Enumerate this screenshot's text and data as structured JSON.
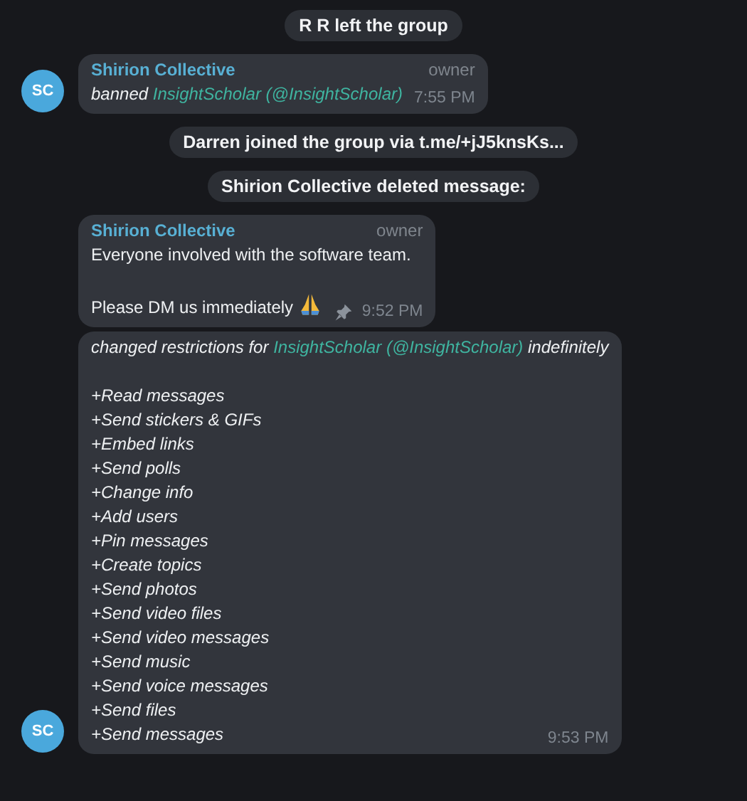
{
  "messages": [
    {
      "kind": "service",
      "text": "R R left the group"
    },
    {
      "kind": "message",
      "author": "Shirion Collective",
      "role": "owner",
      "avatar": "SC",
      "italic": true,
      "pinned": false,
      "time": "7:55 PM",
      "paragraphs": [
        [
          [
            {
              "kind": "text",
              "text": "banned "
            },
            {
              "kind": "link",
              "text": "InsightScholar"
            },
            {
              "kind": "link",
              "text": " (@InsightScholar)"
            }
          ]
        ]
      ]
    },
    {
      "kind": "service",
      "text": "Darren joined the group via t.me/+jJ5knsKs..."
    },
    {
      "kind": "service",
      "text": "Shirion Collective deleted message:"
    },
    {
      "kind": "message",
      "author": "Shirion Collective",
      "role": "owner",
      "italic": false,
      "pinned": true,
      "time": "9:52 PM",
      "paragraphs": [
        [
          [
            {
              "kind": "text",
              "text": "Everyone involved with the software team."
            }
          ]
        ],
        [
          [
            {
              "kind": "text",
              "text": "Please DM us immediately "
            },
            {
              "kind": "emoji"
            }
          ]
        ]
      ]
    },
    {
      "kind": "message",
      "avatar": "SC",
      "italic": true,
      "pinned": false,
      "time": "9:53 PM",
      "paragraphs": [
        [
          [
            {
              "kind": "text",
              "text": "changed restrictions for "
            },
            {
              "kind": "link",
              "text": "InsightScholar"
            },
            {
              "kind": "link",
              "text": " (@InsightScholar)"
            },
            {
              "kind": "text",
              "text": " indefinitely"
            }
          ]
        ],
        [
          [
            {
              "kind": "text",
              "text": "+Read messages"
            }
          ],
          [
            {
              "kind": "text",
              "text": "+Send stickers & GIFs"
            }
          ],
          [
            {
              "kind": "text",
              "text": "+Embed links"
            }
          ],
          [
            {
              "kind": "text",
              "text": "+Send polls"
            }
          ],
          [
            {
              "kind": "text",
              "text": "+Change info"
            }
          ],
          [
            {
              "kind": "text",
              "text": "+Add users"
            }
          ],
          [
            {
              "kind": "text",
              "text": "+Pin messages"
            }
          ],
          [
            {
              "kind": "text",
              "text": "+Create topics"
            }
          ],
          [
            {
              "kind": "text",
              "text": "+Send photos"
            }
          ],
          [
            {
              "kind": "text",
              "text": "+Send video files"
            }
          ],
          [
            {
              "kind": "text",
              "text": "+Send video messages"
            }
          ],
          [
            {
              "kind": "text",
              "text": "+Send music"
            }
          ],
          [
            {
              "kind": "text",
              "text": "+Send voice messages"
            }
          ],
          [
            {
              "kind": "text",
              "text": "+Send files"
            }
          ],
          [
            {
              "kind": "text",
              "text": "+Send messages"
            }
          ]
        ]
      ]
    }
  ]
}
